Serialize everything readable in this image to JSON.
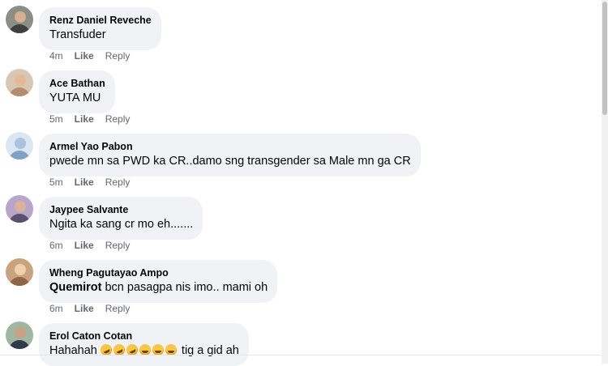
{
  "comments": [
    {
      "author": "Renz Daniel Reveche",
      "text": "Transfuder",
      "time": "4m",
      "like": "Like",
      "reply": "Reply"
    },
    {
      "author": "Ace Bathan",
      "text": "YUTA MU",
      "time": "5m",
      "like": "Like",
      "reply": "Reply"
    },
    {
      "author": "Armel Yao Pabon",
      "text": "pwede mn sa PWD ka CR..damo sng transgender sa Male mn ga CR",
      "time": "5m",
      "like": "Like",
      "reply": "Reply"
    },
    {
      "author": "Jaypee Salvante",
      "text": "Ngita ka sang cr mo eh.......",
      "time": "6m",
      "like": "Like",
      "reply": "Reply"
    },
    {
      "author": "Wheng Pagutayao Ampo",
      "mention": "Quemirot",
      "text": " bcn pasagpa nis imo.. mami oh",
      "time": "6m",
      "like": "Like",
      "reply": "Reply"
    },
    {
      "author": "Erol Caton Cotan",
      "text": "Hahahah",
      "text_after": " tig a gid ah",
      "emojis": [
        "rofl",
        "rofl",
        "rofl",
        "joy",
        "joy",
        "joy"
      ]
    }
  ],
  "colors": {
    "bubble": "#f0f2f5",
    "name": "#050505",
    "meta": "#65676b"
  }
}
